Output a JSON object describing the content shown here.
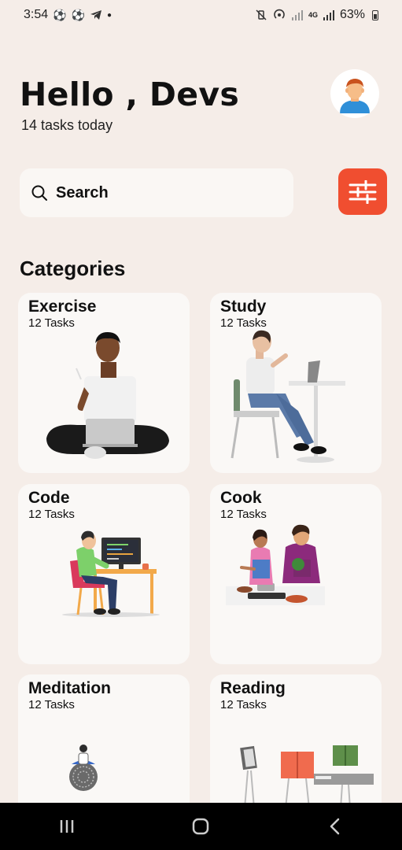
{
  "status_bar": {
    "time": "3:54",
    "left_icons": [
      "soccer-ball-icon",
      "soccer-ball-icon",
      "telegram-icon",
      "dot-icon"
    ],
    "network": "4G",
    "battery": "63%"
  },
  "header": {
    "greeting": "Hello , Devs",
    "subtitle": "14 tasks today",
    "avatar_icon": "person-avatar-icon"
  },
  "search": {
    "placeholder": "Search"
  },
  "section": {
    "title": "Categories"
  },
  "categories": [
    {
      "title": "Exercise",
      "count": "12 Tasks"
    },
    {
      "title": "Study",
      "count": "12 Tasks"
    },
    {
      "title": "Code",
      "count": "12 Tasks"
    },
    {
      "title": "Cook",
      "count": "12 Tasks"
    },
    {
      "title": "Meditation",
      "count": "12 Tasks"
    },
    {
      "title": "Reading",
      "count": "12 Tasks"
    }
  ],
  "colors": {
    "accent": "#f04e30",
    "background": "#f5ede8",
    "card": "#faf8f6"
  }
}
